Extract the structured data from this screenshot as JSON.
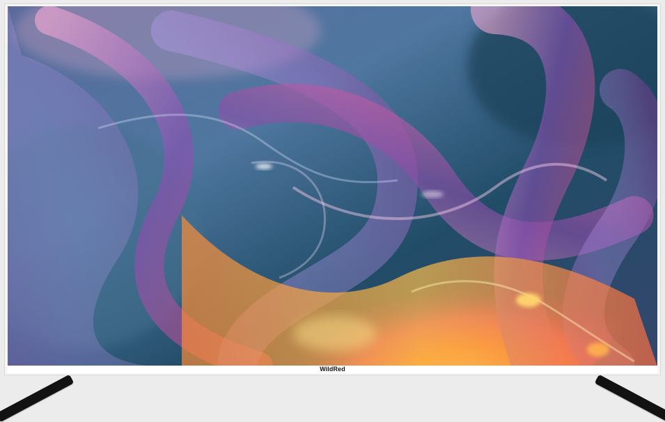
{
  "product": {
    "brand": "WildRed"
  }
}
